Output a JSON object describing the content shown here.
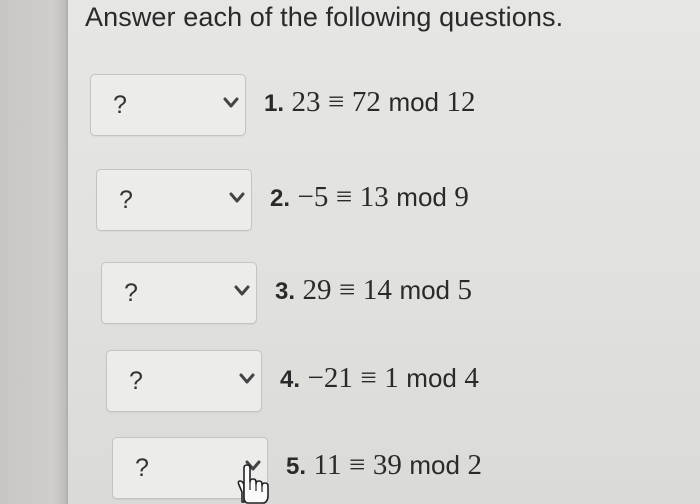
{
  "heading": "Answer each of the following questions.",
  "questions": [
    {
      "number": "1.",
      "lhs": "23",
      "rel": "≡",
      "rhs": "72",
      "mod": "mod",
      "modulus": "12",
      "dropdown": "?"
    },
    {
      "number": "2.",
      "lhs": "−5",
      "rel": "≡",
      "rhs": "13",
      "mod": "mod",
      "modulus": "9",
      "dropdown": "?"
    },
    {
      "number": "3.",
      "lhs": "29",
      "rel": "≡",
      "rhs": "14",
      "mod": "mod",
      "modulus": "5",
      "dropdown": "?"
    },
    {
      "number": "4.",
      "lhs": "−21",
      "rel": "≡",
      "rhs": "1",
      "mod": "mod",
      "modulus": "4",
      "dropdown": "?"
    },
    {
      "number": "5.",
      "lhs": "11",
      "rel": "≡",
      "rhs": "39",
      "mod": "mod",
      "modulus": "2",
      "dropdown": "?"
    }
  ],
  "icons": {
    "dropdown_chevron": "chevron-down-icon",
    "pointer": "hand-pointer-icon"
  },
  "colors": {
    "page_background": "#e4e4e2",
    "text": "#2a2a2a",
    "dropdown_border": "#c4c4c1"
  }
}
